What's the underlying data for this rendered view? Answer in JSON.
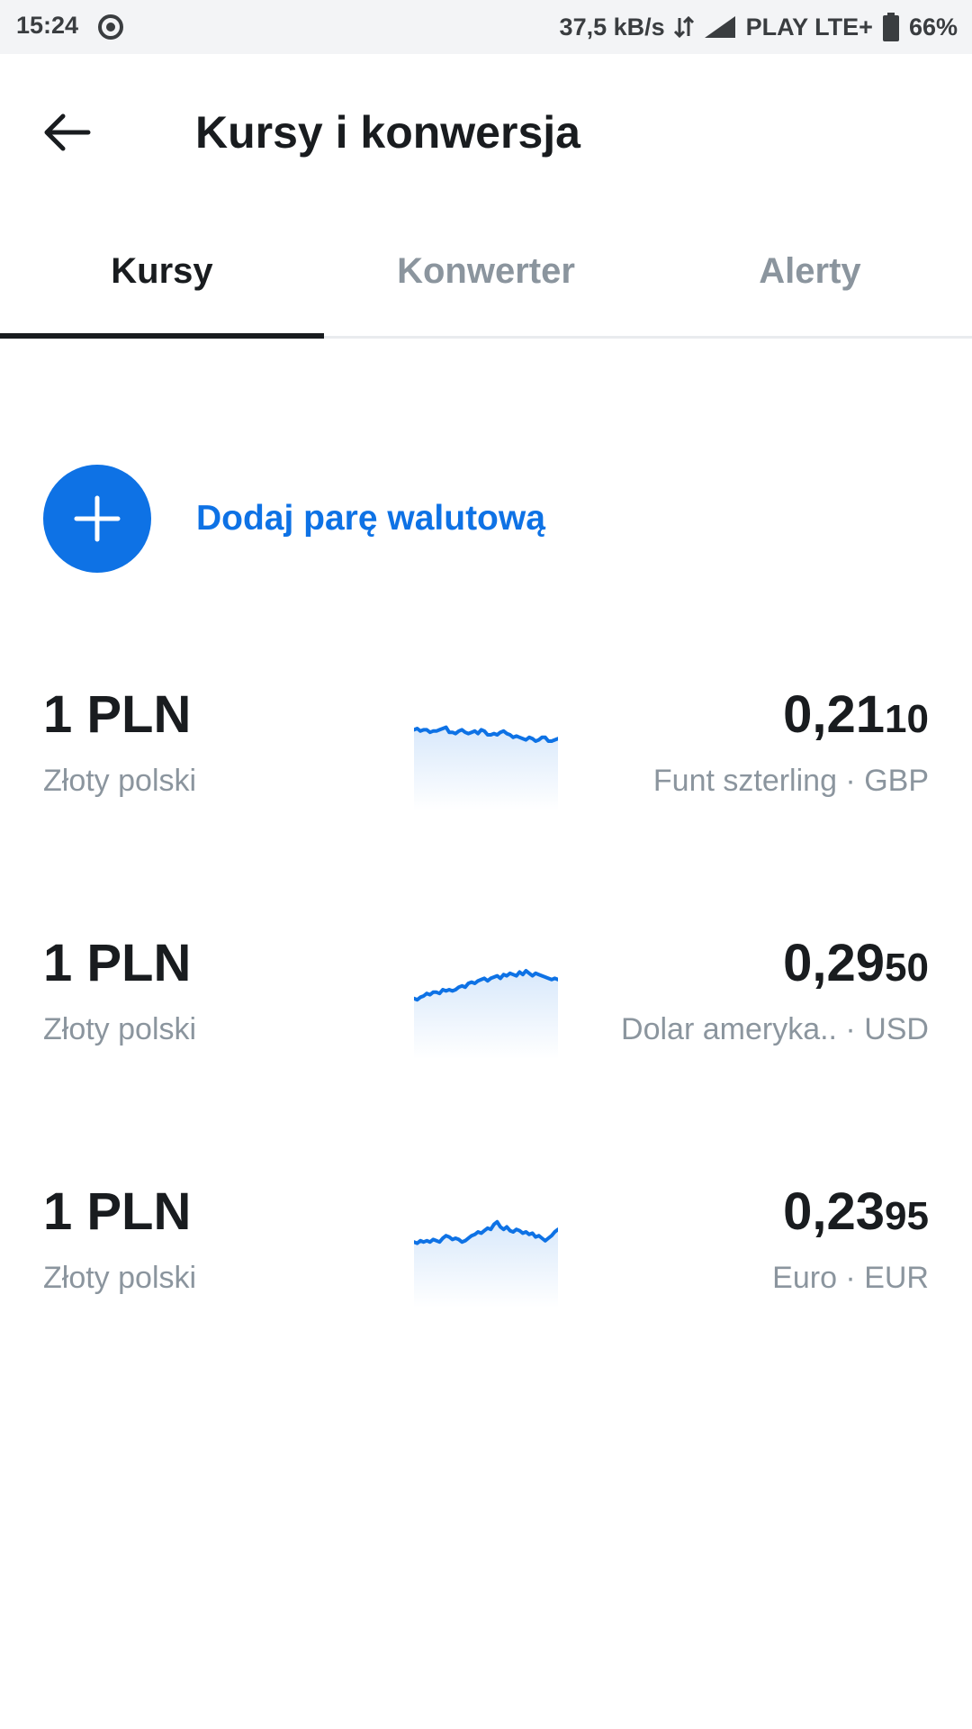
{
  "status_bar": {
    "time": "15:24",
    "sync_icon": "sync-circle-icon",
    "net_speed": "37,5 kB/s",
    "data_icon": "data-arrows-icon",
    "signal_icon": "signal-icon",
    "carrier": "PLAY LTE+",
    "battery_icon": "battery-icon",
    "battery": "66%"
  },
  "app_bar": {
    "back_icon": "back-arrow-icon",
    "title": "Kursy i konwersja"
  },
  "tabs": [
    {
      "label": "Kursy",
      "active": true
    },
    {
      "label": "Konwerter",
      "active": false
    },
    {
      "label": "Alerty",
      "active": false
    }
  ],
  "add_pair": {
    "icon": "plus-icon",
    "label": "Dodaj parę walutową"
  },
  "colors": {
    "accent": "#0e72e5",
    "text_primary": "#191c1f",
    "text_secondary": "#8b959e",
    "status_bar_bg": "#f3f4f6"
  },
  "rates": [
    {
      "base_amount": "1 PLN",
      "base_name": "Złoty polski",
      "value_major": "0,21",
      "value_minor": "10",
      "quote_desc": "Funt szterling · GBP",
      "trend": [
        0.64,
        0.65,
        0.63,
        0.64,
        0.64,
        0.62,
        0.63,
        0.63,
        0.64,
        0.65,
        0.66,
        0.62,
        0.62,
        0.61,
        0.63,
        0.64,
        0.62,
        0.61,
        0.62,
        0.63,
        0.61,
        0.64,
        0.63,
        0.6,
        0.6,
        0.61,
        0.6,
        0.62,
        0.63,
        0.61,
        0.6,
        0.58,
        0.59,
        0.58,
        0.57,
        0.56,
        0.58,
        0.57,
        0.55,
        0.56,
        0.58,
        0.58,
        0.55,
        0.55,
        0.56,
        0.57
      ]
    },
    {
      "base_amount": "1 PLN",
      "base_name": "Złoty polski",
      "value_major": "0,29",
      "value_minor": "50",
      "quote_desc": "Dolar ameryka..  · USD",
      "trend": [
        0.48,
        0.47,
        0.49,
        0.5,
        0.52,
        0.51,
        0.53,
        0.53,
        0.52,
        0.55,
        0.54,
        0.55,
        0.54,
        0.55,
        0.57,
        0.58,
        0.57,
        0.6,
        0.61,
        0.6,
        0.62,
        0.63,
        0.64,
        0.62,
        0.64,
        0.65,
        0.66,
        0.64,
        0.67,
        0.66,
        0.68,
        0.67,
        0.66,
        0.69,
        0.67,
        0.7,
        0.68,
        0.66,
        0.68,
        0.67,
        0.66,
        0.65,
        0.64,
        0.63,
        0.64,
        0.63
      ]
    },
    {
      "base_amount": "1 PLN",
      "base_name": "Złoty polski",
      "value_major": "0,23",
      "value_minor": "95",
      "quote_desc": "Euro · EUR",
      "trend": [
        0.52,
        0.51,
        0.53,
        0.52,
        0.53,
        0.52,
        0.54,
        0.53,
        0.52,
        0.55,
        0.57,
        0.56,
        0.54,
        0.55,
        0.54,
        0.52,
        0.53,
        0.55,
        0.57,
        0.58,
        0.6,
        0.59,
        0.61,
        0.63,
        0.62,
        0.66,
        0.68,
        0.64,
        0.62,
        0.64,
        0.61,
        0.6,
        0.62,
        0.61,
        0.59,
        0.6,
        0.58,
        0.59,
        0.56,
        0.57,
        0.55,
        0.53,
        0.55,
        0.57,
        0.6,
        0.62
      ]
    }
  ]
}
